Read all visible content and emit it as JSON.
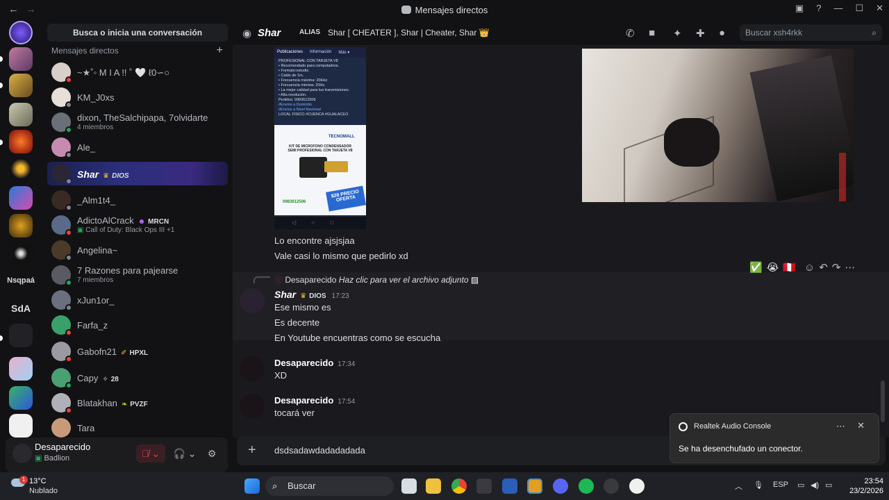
{
  "window": {
    "title": "Mensajes directos"
  },
  "servers": [
    {
      "label": "Nsqpaá"
    },
    {
      "label": "SdA"
    }
  ],
  "dm_panel": {
    "search_label": "Busca o inicia una conversación",
    "header": "Mensajes directos",
    "items": [
      {
        "name": "~★˚◦ M I A !! ˚ 🤍 ℓ0∽○",
        "sub": "",
        "tag": ""
      },
      {
        "name": "KM_J0xs",
        "sub": "",
        "tag": ""
      },
      {
        "name": "dixon, TheSalchipapa, 7olvidarte",
        "sub": "4 miembros",
        "tag": ""
      },
      {
        "name": "Ale_",
        "sub": "",
        "tag": ""
      },
      {
        "name": "Shar",
        "sub": "",
        "tag": "DIOS"
      },
      {
        "name": "_Alm1t4_",
        "sub": "",
        "tag": ""
      },
      {
        "name": "AdictoAlCrack",
        "sub": "Call of Duty: Black Ops III +1",
        "tag": "MRCN"
      },
      {
        "name": "Angelina~",
        "sub": "",
        "tag": ""
      },
      {
        "name": "7 Razones para pajearse",
        "sub": "7 miembros",
        "tag": ""
      },
      {
        "name": "xJun1or_",
        "sub": "",
        "tag": ""
      },
      {
        "name": "Farfa_z",
        "sub": "",
        "tag": ""
      },
      {
        "name": "Gabofn21",
        "sub": "",
        "tag": "HPXL"
      },
      {
        "name": "Capy",
        "sub": "",
        "tag": "28"
      },
      {
        "name": "Blatakhan",
        "sub": "",
        "tag": "PVZF"
      },
      {
        "name": "Tara",
        "sub": "",
        "tag": ""
      }
    ]
  },
  "user": {
    "name": "Desaparecido",
    "status": "Badlion"
  },
  "chat_header": {
    "name": "Shar",
    "alias_label": "ALIAS",
    "alias_value": "Shar [ CHEATER ], Shar | Cheater, Shar 👑",
    "search_placeholder": "Buscar xsh4rkk"
  },
  "attachment": {
    "tabs": [
      "Publicaciones",
      "Información",
      "Más ▾"
    ],
    "lines": [
      "PROFESIONAL CON TARJETA V8",
      "• Recomendado para computadora.",
      "• Formato:estudio.",
      "• Cable de 1m.",
      "• Frecuencia máxima: 20kHz.",
      "• Frecuencia mínima: 20Hz.",
      "• La mejor calidad para tus transmisiones.",
      "• Alta resolución.",
      "Pedidos: 0983612506",
      "#Envios a Domicilio",
      "#Envios a Nivel Nacional",
      "LOCAL FISICO #CUENCA #GUALACEO"
    ],
    "brand": "TECNOMALL",
    "product": "KIT DE MICROFONO CONDENSADOR SEMI PROFESIONAL CON TARJETA V8",
    "price": "$28 PRECIO OFERTA",
    "phone": "0983612506"
  },
  "messages": {
    "prev_lines": [
      "Lo encontre ajsjsjaa",
      "Vale casi lo mismo que pedirlo xd"
    ],
    "reply_author": "Desaparecido",
    "reply_text": "Haz clic para ver el archivo adjunto",
    "groups": [
      {
        "author": "Shar",
        "tag": "DIOS",
        "time": "17:23",
        "lines": [
          "Ese mismo es",
          "Es decente",
          "En Youtube encuentras como se escucha"
        ]
      },
      {
        "author": "Desaparecido",
        "tag": "",
        "time": "17:34",
        "lines": [
          "XD"
        ]
      },
      {
        "author": "Desaparecido",
        "tag": "",
        "time": "17:54",
        "lines": [
          "tocará ver"
        ]
      }
    ],
    "reactions": [
      "✅",
      "😭",
      "🇵🇪"
    ]
  },
  "composer": {
    "value": "dsdsadawdadadadada"
  },
  "toast": {
    "app": "Realtek Audio Console",
    "message": "Se ha desenchufado un conector."
  },
  "taskbar": {
    "weather_temp": "13°C",
    "weather_desc": "Nublado",
    "search": "Buscar",
    "lang": "ESP",
    "time": "23:54",
    "date": "23/2/2026",
    "badge": "1"
  }
}
